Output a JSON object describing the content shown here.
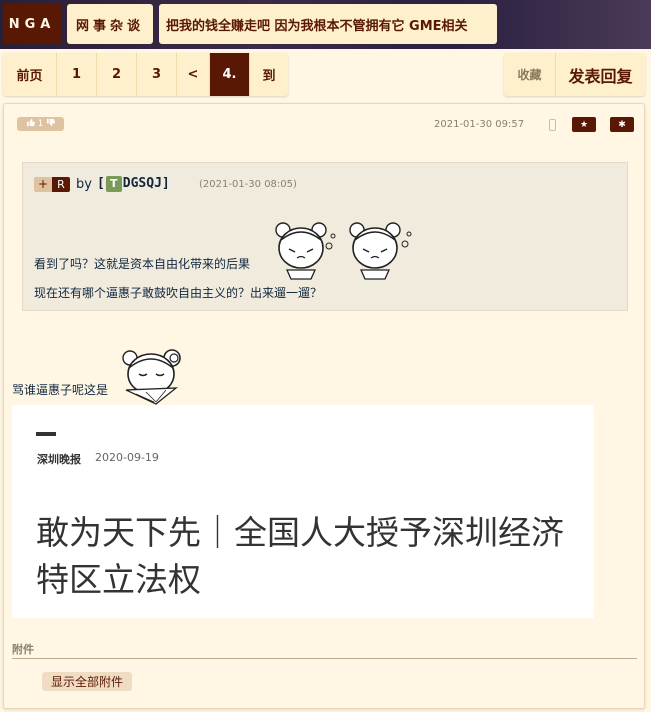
{
  "header": {
    "logo": "NGA",
    "forum": "网事杂谈",
    "thread_title": "把我的钱全赚走吧 因为我根本不管拥有它 GME相关"
  },
  "pager": {
    "first": "前页",
    "pages": [
      "1",
      "2",
      "3"
    ],
    "prev": "<",
    "current": "4.",
    "goto": "到"
  },
  "actions": {
    "favorite": "收藏",
    "reply": "发表回复"
  },
  "post": {
    "vote_count": "1",
    "time": "2021-01-30 09:57",
    "quote": {
      "plus": "+",
      "r": "R",
      "by": "by",
      "user_bracket_open": "[",
      "user_badge": "T",
      "user_name": "DGSQJ",
      "user_bracket_close": "]",
      "time": "(2021-01-30 08:05)",
      "line1": "看到了吗？这就是资本自由化带来的后果",
      "line2": "现在还有哪个逼惠子敢鼓吹自由主义的？出来遛一遛？"
    },
    "text": "骂谁逼惠子呢这是",
    "article": {
      "source": "深圳晚报",
      "date": "2020-09-19",
      "title": "敢为天下先｜全国人大授予深圳经济特区立法权"
    },
    "attachments_label": "附件",
    "show_all_attachments": "显示全部附件"
  },
  "colors": {
    "brand": "#591804",
    "background": "#fff7e3",
    "panel": "#fff0cd",
    "quote_bg": "#f1ebde"
  }
}
